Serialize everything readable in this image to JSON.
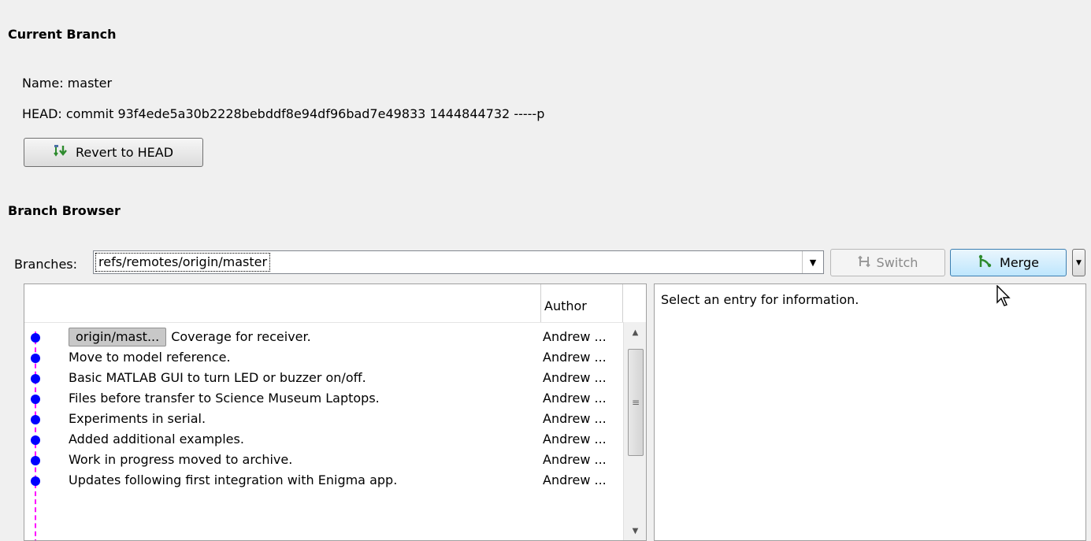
{
  "current_branch": {
    "title": "Current Branch",
    "name_line": "Name: master",
    "head_line": "HEAD: commit 93f4ede5a30b2228bebddf8e94df96bad7e49833 1444844732 -----p",
    "revert_label": "Revert to HEAD"
  },
  "branch_browser": {
    "title": "Branch Browser",
    "branches_label": "Branches:",
    "selected_branch": "refs/remotes/origin/master",
    "switch_label": "Switch",
    "merge_label": "Merge",
    "table": {
      "author_header": "Author",
      "rows": [
        {
          "tag": "origin/mast...",
          "message": "Coverage for receiver.",
          "author": "Andrew ..."
        },
        {
          "tag": "",
          "message": "Move to model reference.",
          "author": "Andrew ..."
        },
        {
          "tag": "",
          "message": "Basic MATLAB GUI to turn LED or buzzer on/off.",
          "author": "Andrew ..."
        },
        {
          "tag": "",
          "message": "Files before transfer to Science Museum Laptops.",
          "author": "Andrew ..."
        },
        {
          "tag": "",
          "message": "Experiments in serial.",
          "author": "Andrew ..."
        },
        {
          "tag": "",
          "message": "Added additional examples.",
          "author": "Andrew ..."
        },
        {
          "tag": "",
          "message": "Work in progress moved to archive.",
          "author": "Andrew ..."
        },
        {
          "tag": "",
          "message": "Updates following first integration with Enigma app.",
          "author": "Andrew ..."
        }
      ]
    },
    "info_text": "Select an entry for information."
  },
  "colors": {
    "graph_node": "#0000ff",
    "graph_line": "#ff00ff",
    "merge_icon": "#2e8b2e"
  }
}
